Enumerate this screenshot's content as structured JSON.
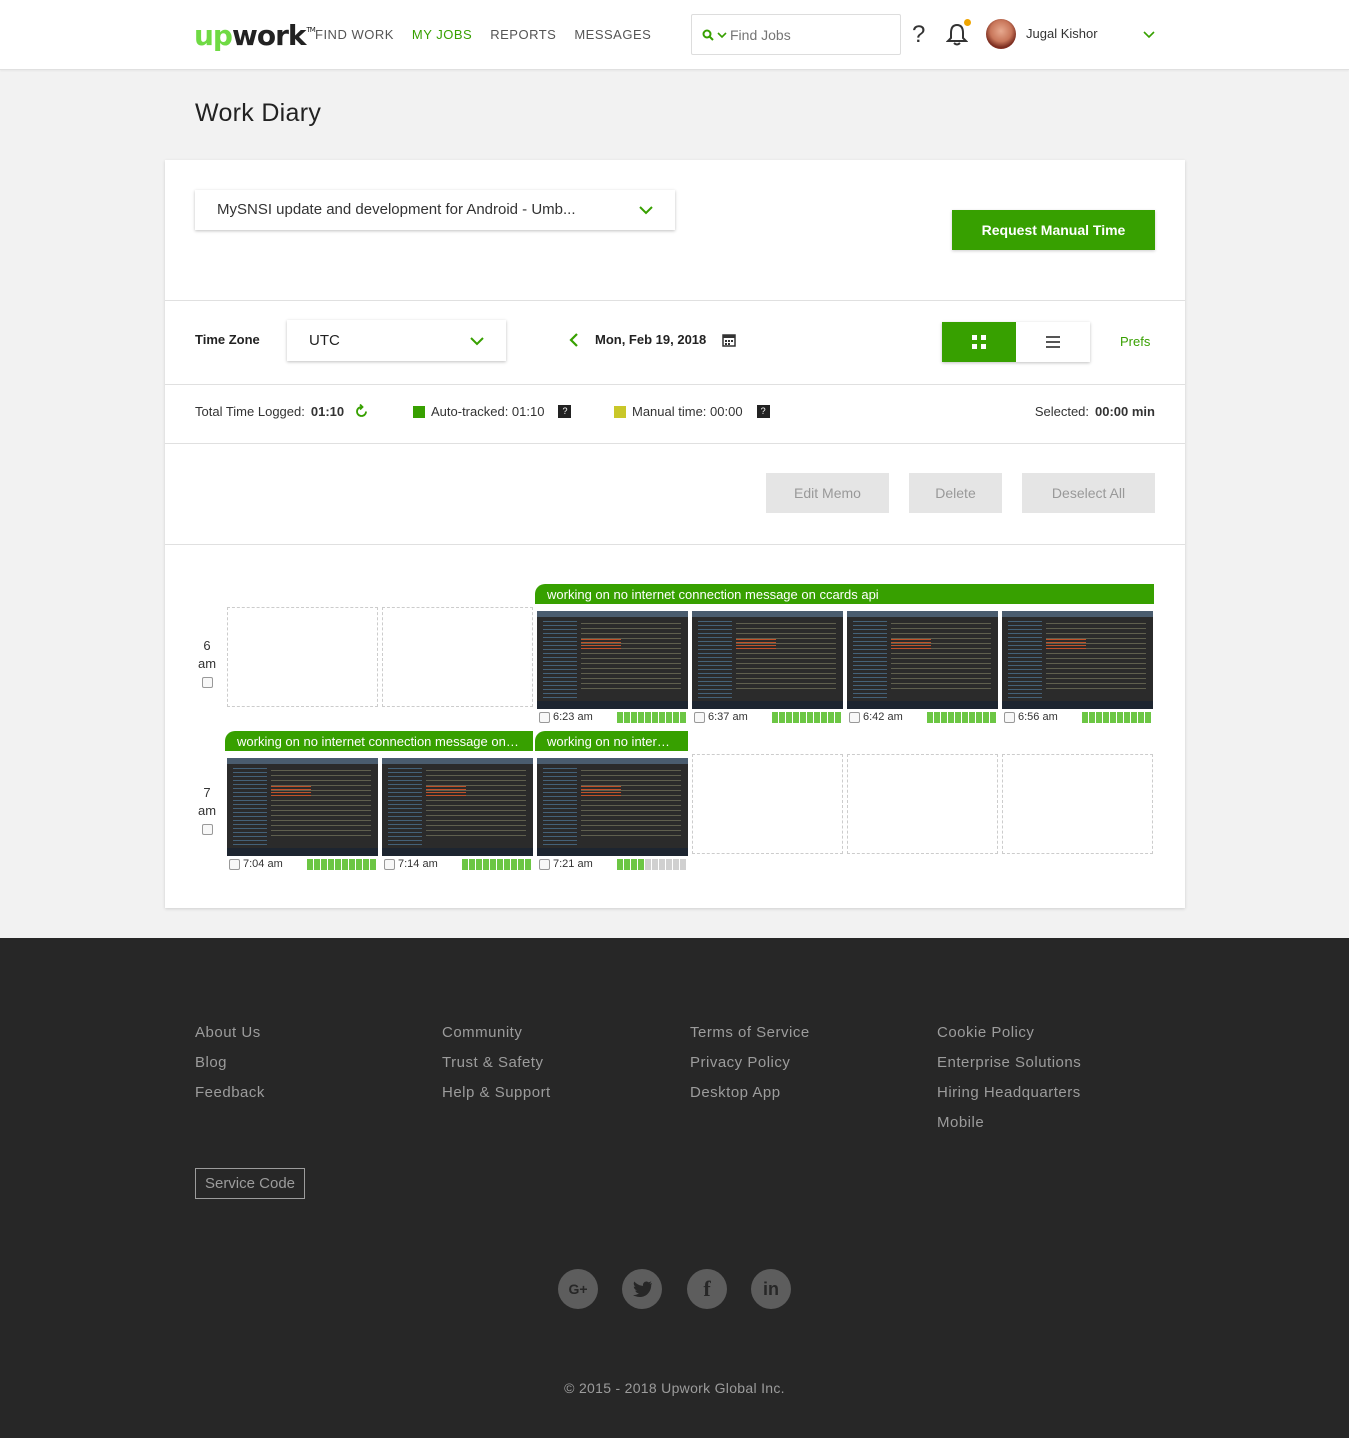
{
  "header": {
    "logo_up": "up",
    "logo_work": "work",
    "logo_tm": "TM",
    "nav": [
      "FIND WORK",
      "MY JOBS",
      "REPORTS",
      "MESSAGES"
    ],
    "search_placeholder": "Find Jobs",
    "help": "?",
    "username": "Jugal Kishor"
  },
  "page_title": "Work Diary",
  "contract": {
    "selected": "MySNSI update and development for Android - Umb...",
    "request_button": "Request Manual Time"
  },
  "controls": {
    "timezone_label": "Time Zone",
    "timezone_value": "UTC",
    "date": "Mon, Feb 19, 2018",
    "prefs": "Prefs"
  },
  "stats": {
    "total_label": "Total Time Logged:",
    "total_value": "01:10",
    "auto_label": "Auto-tracked: 01:10",
    "manual_label": "Manual time: 00:00",
    "selected_label": "Selected:",
    "selected_value": "00:00 min",
    "auto_color": "#37a000",
    "manual_color": "#c9c729"
  },
  "actions": {
    "edit_memo": "Edit Memo",
    "delete": "Delete",
    "deselect_all": "Deselect All"
  },
  "diary": {
    "rows": [
      {
        "hour": "6",
        "ampm": "am",
        "memos": [
          {
            "text": "working on no internet connection message on ccards api"
          }
        ],
        "shots": [
          {
            "time": "6:23 am",
            "activity": 10
          },
          {
            "time": "6:37 am",
            "activity": 10
          },
          {
            "time": "6:42 am",
            "activity": 10
          },
          {
            "time": "6:56 am",
            "activity": 10
          }
        ]
      },
      {
        "hour": "7",
        "ampm": "am",
        "memos": [
          {
            "text": "working on no internet connection message on ccards api"
          },
          {
            "text": "working on no internet connection message on ccards api"
          }
        ],
        "shots": [
          {
            "time": "7:04 am",
            "activity": 10
          },
          {
            "time": "7:14 am",
            "activity": 10
          },
          {
            "time": "7:21 am",
            "activity": 4
          }
        ]
      }
    ]
  },
  "footer": {
    "col1": [
      "About Us",
      "Blog",
      "Feedback"
    ],
    "col2": [
      "Community",
      "Trust & Safety",
      "Help & Support"
    ],
    "col3": [
      "Terms of Service",
      "Privacy Policy",
      "Desktop App"
    ],
    "col4": [
      "Cookie Policy",
      "Enterprise Solutions",
      "Hiring Headquarters",
      "Mobile"
    ],
    "service_code": "Service Code",
    "social": [
      "google-plus-icon",
      "twitter-icon",
      "facebook-icon",
      "linkedin-icon"
    ],
    "copyright": "© 2015 - 2018 Upwork Global Inc."
  }
}
